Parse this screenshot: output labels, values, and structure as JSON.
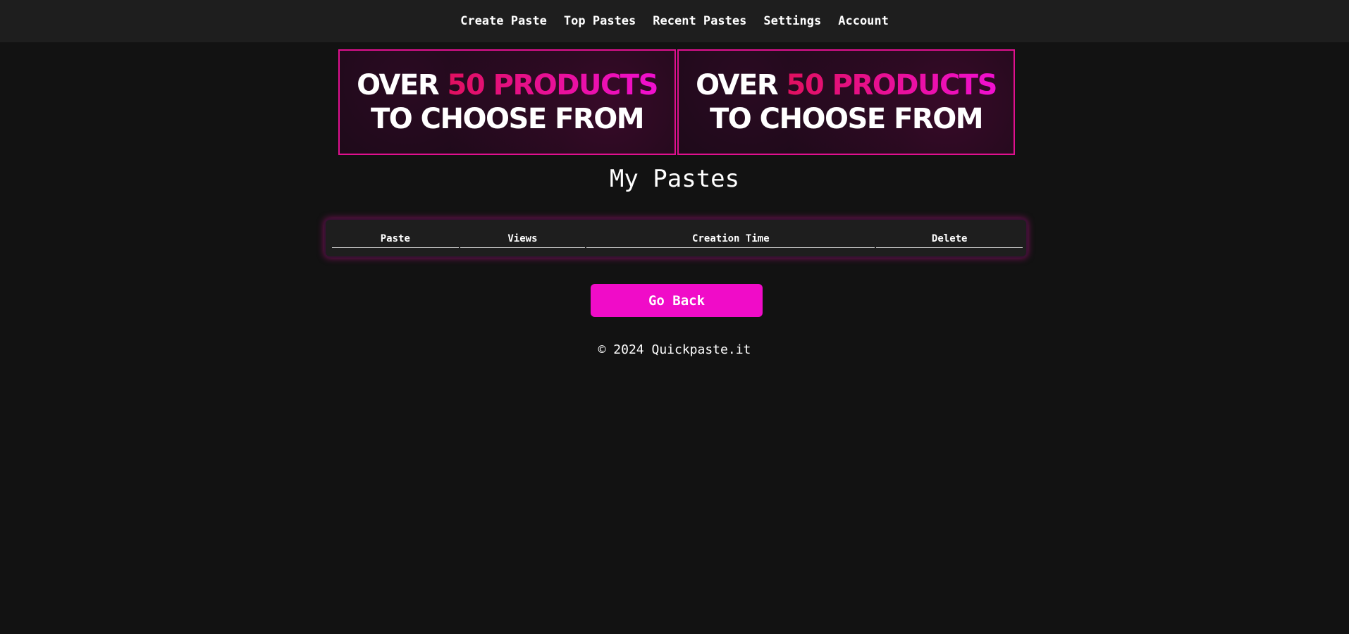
{
  "nav": {
    "items": [
      {
        "label": "Create Paste"
      },
      {
        "label": "Top Pastes"
      },
      {
        "label": "Recent Pastes"
      },
      {
        "label": "Settings"
      },
      {
        "label": "Account"
      }
    ]
  },
  "ads": [
    {
      "line1_plain": "OVER ",
      "line1_accent": "50 PRODUCTS",
      "line2": "TO CHOOSE FROM"
    },
    {
      "line1_plain": "OVER ",
      "line1_accent": "50 PRODUCTS",
      "line2": "TO CHOOSE FROM"
    }
  ],
  "main": {
    "title": "My Pastes",
    "table": {
      "headers": [
        "Paste",
        "Views",
        "Creation Time",
        "Delete"
      ],
      "rows": []
    },
    "go_back_label": "Go Back"
  },
  "footer": {
    "text": "© 2024 Quickpaste.it"
  },
  "colors": {
    "accent": "#f00cc8",
    "background": "#121212",
    "nav_background": "#1e1e1e",
    "ad_border": "#e0108f"
  }
}
